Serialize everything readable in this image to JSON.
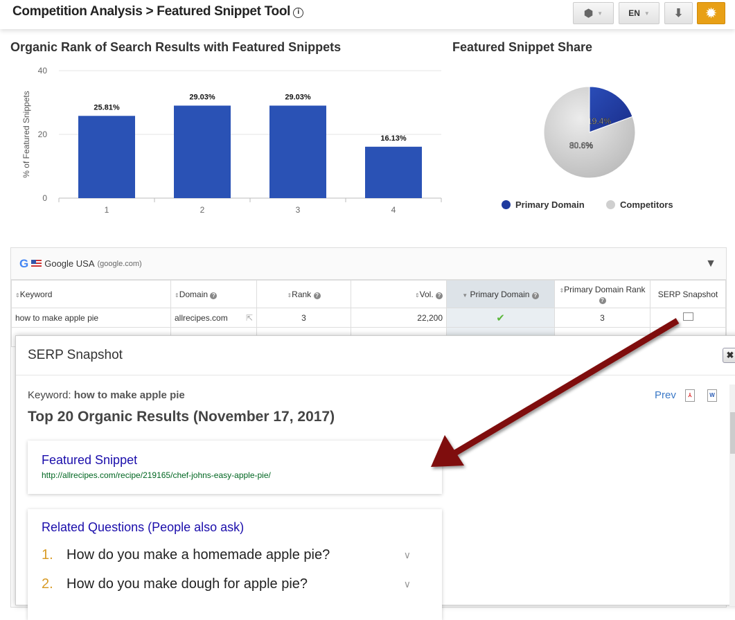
{
  "header": {
    "title": "Competition Analysis > Featured Snippet Tool",
    "info_icon": "info-icon",
    "lang": "EN"
  },
  "bar_title": "Organic Rank of Search Results with Featured Snippets",
  "pie_title": "Featured Snippet Share",
  "chart_data": [
    {
      "type": "bar",
      "title": "Organic Rank of Search Results with Featured Snippets",
      "xlabel": "",
      "ylabel": "% of Featured Snippets",
      "categories": [
        "1",
        "2",
        "3",
        "4"
      ],
      "values": [
        25.81,
        29.03,
        29.03,
        16.13
      ],
      "labels": [
        "25.81%",
        "29.03%",
        "29.03%",
        "16.13%"
      ],
      "ylim": [
        0,
        40
      ],
      "yticks": [
        "0",
        "20",
        "40"
      ],
      "color": "#2a52b5",
      "grid": true
    },
    {
      "type": "pie",
      "title": "Featured Snippet Share",
      "slices": [
        {
          "name": "Primary Domain",
          "value": 19.4,
          "label": "19.4%",
          "color": "#1f3a9e"
        },
        {
          "name": "Competitors",
          "value": 80.6,
          "label": "80.6%",
          "color": "#cfcfcf"
        }
      ],
      "legend": "bottom"
    }
  ],
  "grid": {
    "engine": "Google USA",
    "domain": "(google.com)",
    "columns": [
      "Keyword",
      "Domain",
      "Rank",
      "Vol.",
      "Primary Domain",
      "Primary Domain Rank",
      "SERP Snapshot"
    ],
    "rows": [
      {
        "keyword": "how to make apple pie",
        "domain": "allrecipes.com",
        "rank": "3",
        "vol": "22,200",
        "primary": "✔",
        "primary_rank": "3"
      }
    ]
  },
  "modal": {
    "title": "SERP Snapshot",
    "close": "✖",
    "keyword_label": "Keyword:",
    "keyword": "how to make apple pie",
    "heading": "Top 20 Organic Results (November 17, 2017)",
    "prev": "Prev",
    "featured": {
      "title": "Featured Snippet",
      "url": "http://allrecipes.com/recipe/219165/chef-johns-easy-apple-pie/"
    },
    "related": {
      "title": "Related Questions (People also ask)",
      "items": [
        {
          "n": "1.",
          "q": "How do you make a homemade apple pie?"
        },
        {
          "n": "2.",
          "q": "How do you make dough for apple pie?"
        }
      ]
    }
  }
}
